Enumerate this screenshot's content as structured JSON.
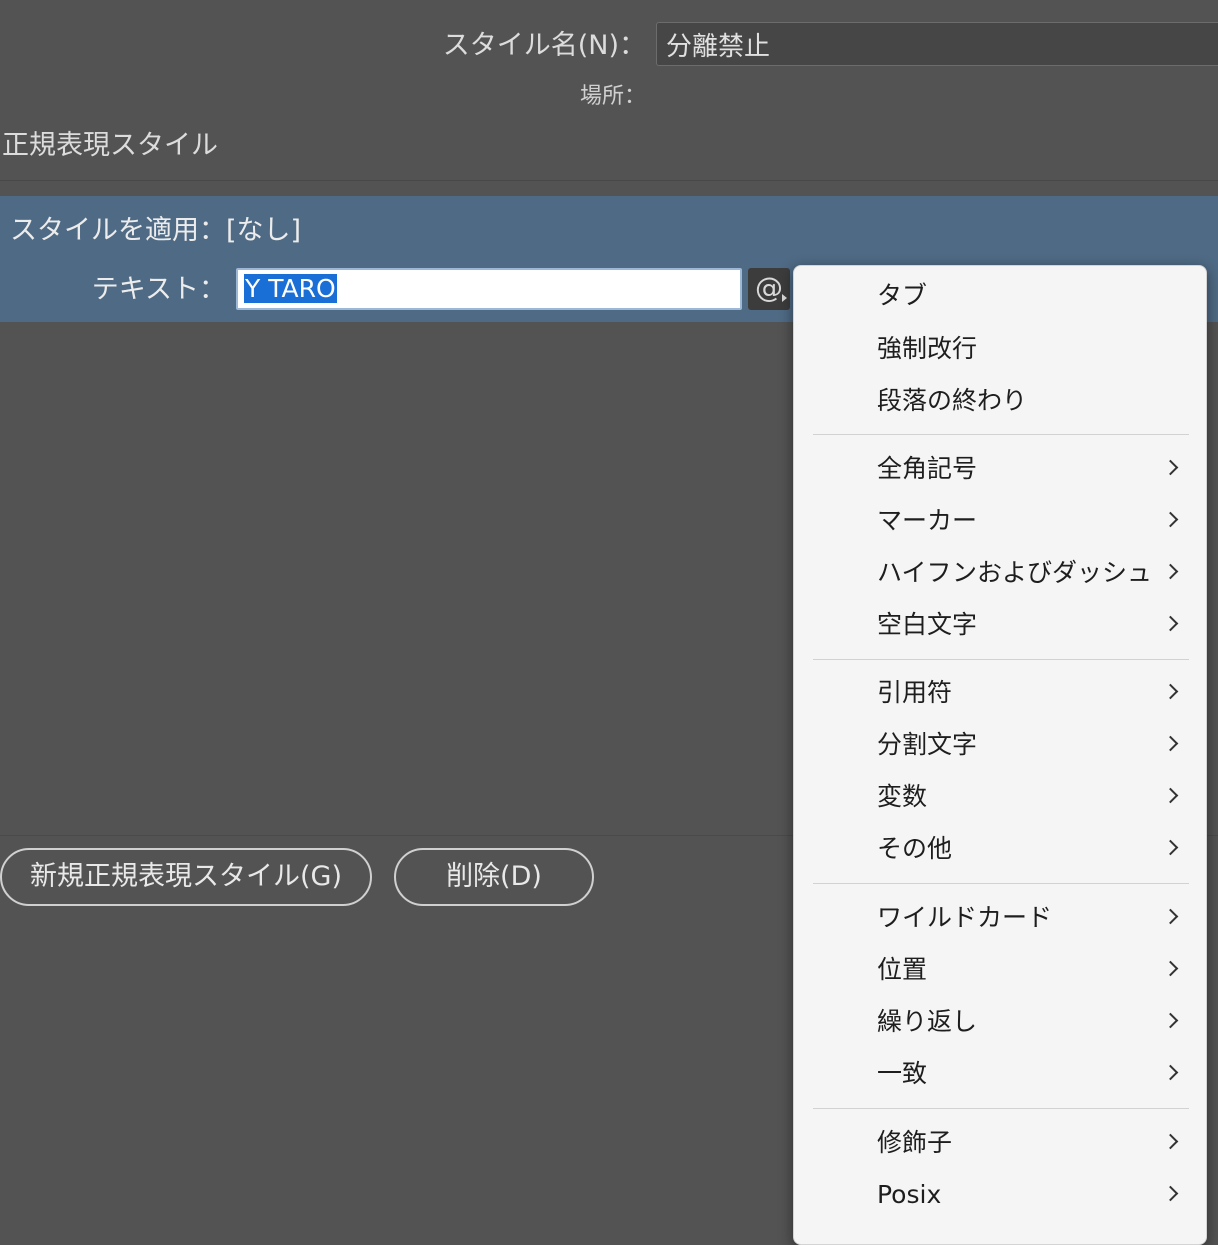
{
  "header": {
    "style_name_label": "スタイル名(N)：",
    "style_name_value": "分離禁止",
    "location_label": "場所："
  },
  "section_title": "正規表現スタイル",
  "rule": {
    "apply_style_label": "スタイルを適用：[なし]",
    "text_label": "テキスト：",
    "text_value": "Y TARO",
    "special_char_button": "@"
  },
  "buttons": {
    "new_style": "新規正規表現スタイル(G)",
    "delete": "削除(D)"
  },
  "menu": {
    "items": [
      {
        "label": "タブ",
        "submenu": false
      },
      {
        "label": "強制改行",
        "submenu": false
      },
      {
        "label": "段落の終わり",
        "submenu": false
      },
      {
        "label": "全角記号",
        "submenu": true
      },
      {
        "label": "マーカー",
        "submenu": true
      },
      {
        "label": "ハイフンおよびダッシュ",
        "submenu": true
      },
      {
        "label": "空白文字",
        "submenu": true
      },
      {
        "label": "引用符",
        "submenu": true
      },
      {
        "label": "分割文字",
        "submenu": true
      },
      {
        "label": "変数",
        "submenu": true
      },
      {
        "label": "その他",
        "submenu": true
      },
      {
        "label": "ワイルドカード",
        "submenu": true
      },
      {
        "label": "位置",
        "submenu": true
      },
      {
        "label": "繰り返し",
        "submenu": true
      },
      {
        "label": "一致",
        "submenu": true
      },
      {
        "label": "修飾子",
        "submenu": true
      },
      {
        "label": "Posix",
        "submenu": true
      }
    ]
  },
  "colors": {
    "background": "#535353",
    "selected_row": "#4f6a85",
    "selection_highlight": "#1a6fd6",
    "menu_background": "#f5f5f5"
  }
}
